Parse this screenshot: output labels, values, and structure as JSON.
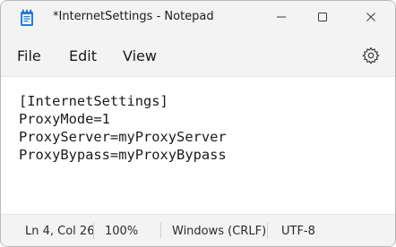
{
  "window": {
    "title": "*InternetSettings - Notepad"
  },
  "icons": {
    "app": "notepad-icon",
    "minimize": "minimize-icon",
    "maximize": "maximize-icon",
    "close": "close-icon",
    "settings": "gear-icon"
  },
  "menu": {
    "file": "File",
    "edit": "Edit",
    "view": "View"
  },
  "editor": {
    "lines": [
      "[InternetSettings]",
      "ProxyMode=1",
      "ProxyServer=myProxyServer",
      "ProxyBypass=myProxyBypass"
    ]
  },
  "status": {
    "position": "Ln 4, Col 26",
    "zoom": "100%",
    "line_ending": "Windows (CRLF)",
    "encoding": "UTF-8"
  },
  "colors": {
    "chrome": "#f3f3f3",
    "editor_bg": "#ffffff",
    "text": "#1b1b1b",
    "icon_blue": "#1f6fc1"
  }
}
